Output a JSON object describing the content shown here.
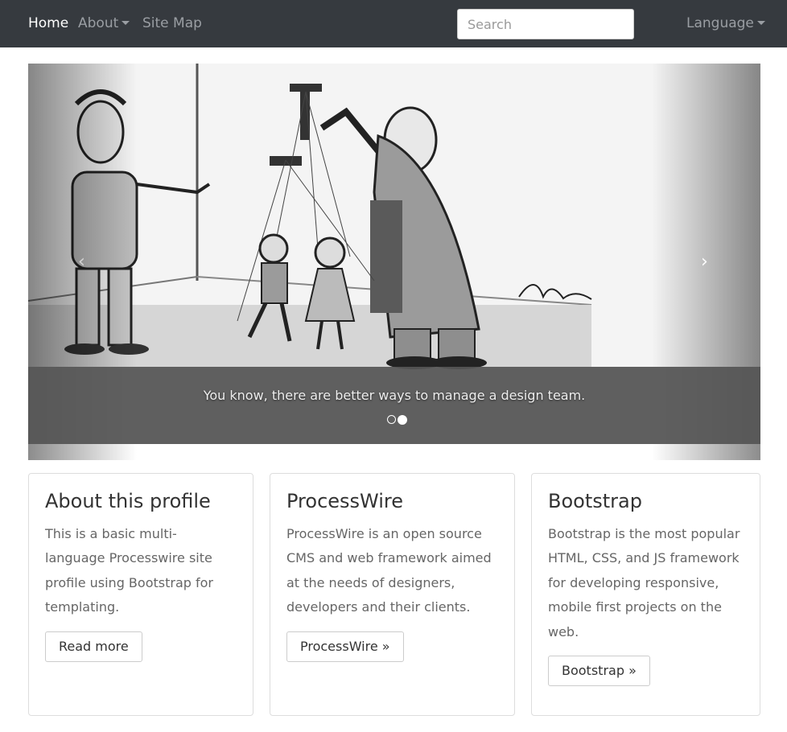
{
  "navbar": {
    "home": "Home",
    "about": "About",
    "site_map": "Site Map",
    "search_placeholder": "Search",
    "language": "Language"
  },
  "carousel": {
    "caption": "You know, there are better ways to manage a design team.",
    "prev": "‹",
    "next": "›",
    "slide_count": 2,
    "active_slide": 2
  },
  "panels": [
    {
      "title": "About this profile",
      "text": "This is a basic multi-language Processwire site profile using Bootstrap for templating.",
      "button": "Read more"
    },
    {
      "title": "ProcessWire",
      "text": "ProcessWire is an open source CMS and web framework aimed at the needs of designers, developers and their clients.",
      "button": "ProcessWire »"
    },
    {
      "title": "Bootstrap",
      "text": "Bootstrap is the most popular HTML, CSS, and JS framework for developing responsive, mobile first projects on the web.",
      "button": "Bootstrap »"
    }
  ],
  "colors": {
    "navbar_bg": "#363a3f",
    "caption_bg": "#555555"
  }
}
